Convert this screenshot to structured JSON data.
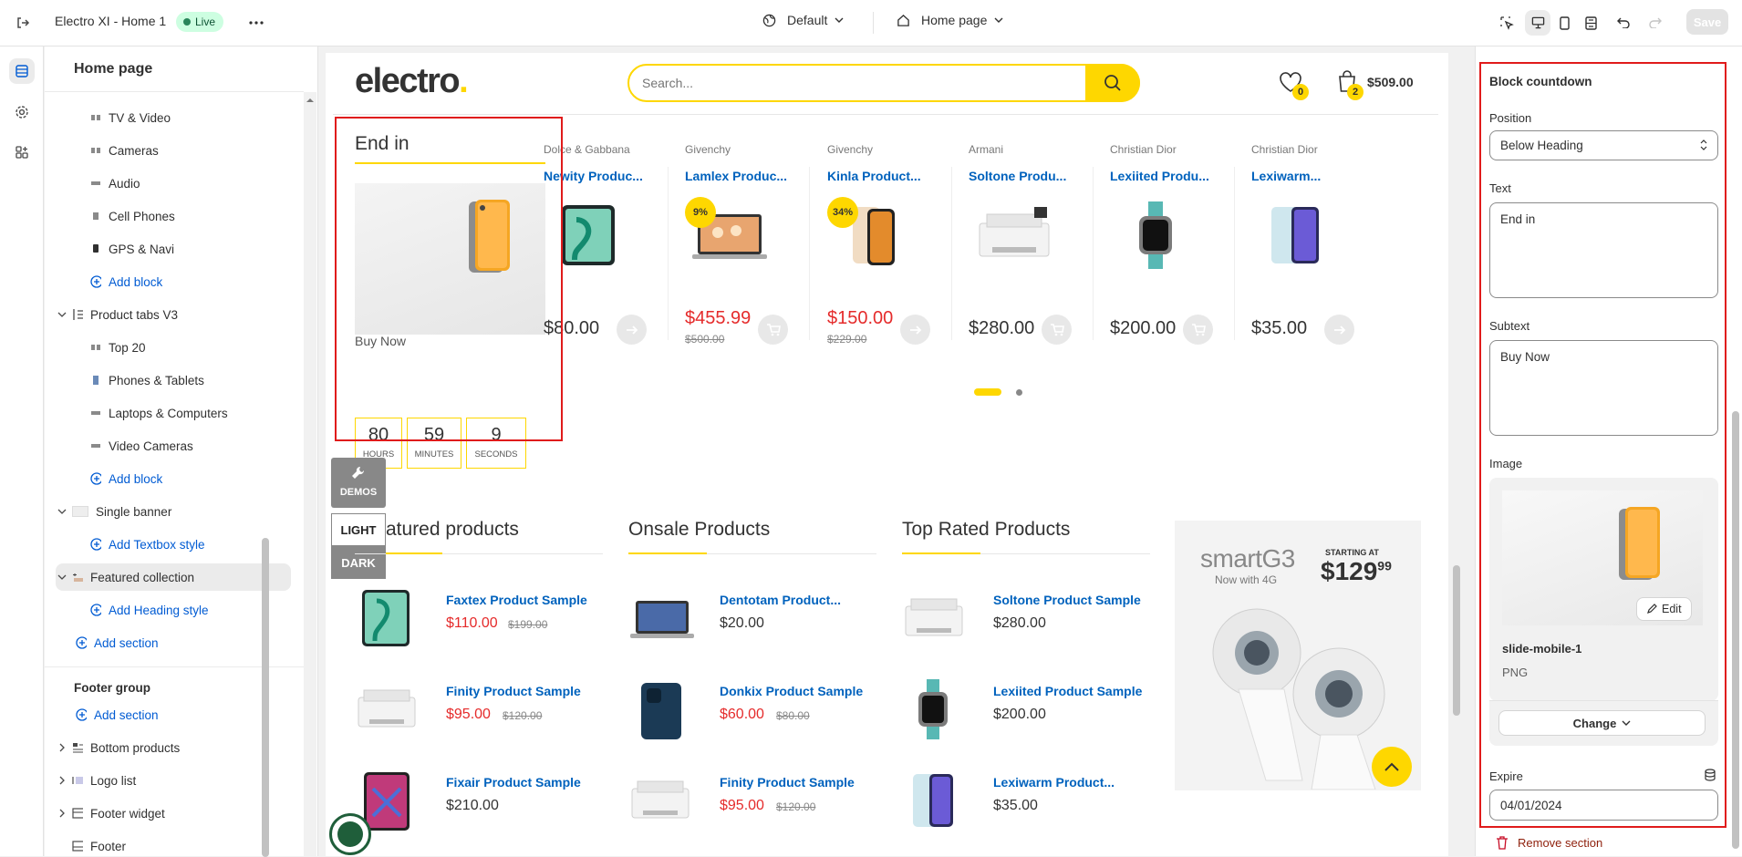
{
  "topbar": {
    "title": "Electro XI - Home 1",
    "status": "Live",
    "theme_select": "Default",
    "page_select": "Home page",
    "save_label": "Save"
  },
  "sidebar": {
    "heading": "Home page",
    "items": [
      {
        "label": "TV & Video"
      },
      {
        "label": "Cameras"
      },
      {
        "label": "Audio"
      },
      {
        "label": "Cell Phones"
      },
      {
        "label": "GPS & Navi"
      },
      {
        "label": "Add block"
      },
      {
        "label": "Product tabs V3"
      },
      {
        "label": "Top 20"
      },
      {
        "label": "Phones & Tablets"
      },
      {
        "label": "Laptops & Computers"
      },
      {
        "label": "Video Cameras"
      },
      {
        "label": "Add block"
      },
      {
        "label": "Single banner"
      },
      {
        "label": "Add Textbox style"
      },
      {
        "label": "Featured collection"
      },
      {
        "label": "Add Heading style"
      },
      {
        "label": "Add section"
      },
      {
        "label": "Footer group"
      },
      {
        "label": "Add section"
      },
      {
        "label": "Bottom products"
      },
      {
        "label": "Logo list"
      },
      {
        "label": "Footer widget"
      },
      {
        "label": "Footer"
      }
    ]
  },
  "store": {
    "logo": "electro",
    "search_placeholder": "Search...",
    "wishlist_count": "0",
    "cart_count": "2",
    "cart_total": "$509.00",
    "countdown": {
      "title": "End in",
      "subtext": "Buy Now",
      "hours": "80",
      "hours_label": "HOURS",
      "minutes": "59",
      "minutes_label": "MINUTES",
      "seconds": "9",
      "seconds_label": "SECONDS"
    },
    "products": [
      {
        "brand": "Dolce & Gabbana",
        "name": "Newity Produc...",
        "price": "$80.00",
        "old": "",
        "badge": ""
      },
      {
        "brand": "Givenchy",
        "name": "Lamlex Produc...",
        "price": "$455.99",
        "old": "$500.00",
        "badge": "9%"
      },
      {
        "brand": "Givenchy",
        "name": "Kinla Product...",
        "price": "$150.00",
        "old": "$229.00",
        "badge": "34%"
      },
      {
        "brand": "Armani",
        "name": "Soltone Produ...",
        "price": "$280.00",
        "old": "",
        "badge": ""
      },
      {
        "brand": "Christian Dior",
        "name": "Lexiited Produ...",
        "price": "$200.00",
        "old": "",
        "badge": ""
      },
      {
        "brand": "Christian Dior",
        "name": "Lexiwarm...",
        "price": "$35.00",
        "old": "",
        "badge": ""
      }
    ],
    "switcher": {
      "demos": "DEMOS",
      "light": "LIGHT",
      "dark": "DARK"
    },
    "columns": [
      {
        "title": "Featured products",
        "visible_title": "atured products",
        "items": [
          {
            "name": "Faxtex Product Sample",
            "price": "$110.00",
            "old": "$199.00"
          },
          {
            "name": "Finity Product Sample",
            "price": "$95.00",
            "old": "$120.00"
          },
          {
            "name": "Fixair Product Sample",
            "price": "$210.00",
            "old": ""
          }
        ]
      },
      {
        "title": "Onsale Products",
        "items": [
          {
            "name": "Dentotam Product...",
            "price": "$20.00",
            "old": ""
          },
          {
            "name": "Donkix Product Sample",
            "price": "$60.00",
            "old": "$80.00"
          },
          {
            "name": "Finity Product Sample",
            "price": "$95.00",
            "old": "$120.00"
          }
        ]
      },
      {
        "title": "Top Rated Products",
        "items": [
          {
            "name": "Soltone Product Sample",
            "price": "$280.00",
            "old": ""
          },
          {
            "name": "Lexiited Product Sample",
            "price": "$200.00",
            "old": ""
          },
          {
            "name": "Lexiwarm Product...",
            "price": "$35.00",
            "old": ""
          }
        ]
      }
    ],
    "banner": {
      "brand": "smartG3",
      "sub": "Now with 4G",
      "starting": "STARTING AT",
      "price_main": "$129",
      "price_cents": "99"
    }
  },
  "panel": {
    "title": "Block countdown",
    "position_label": "Position",
    "position_value": "Below Heading",
    "text_label": "Text",
    "text_value": "End in",
    "subtext_label": "Subtext",
    "subtext_value": "Buy Now",
    "image_label": "Image",
    "edit_label": "Edit",
    "image_name": "slide-mobile-1",
    "image_type": "PNG",
    "change_label": "Change",
    "expire_label": "Expire",
    "expire_value": "04/01/2024",
    "remove_label": "Remove section"
  },
  "colors": {
    "accent": "#fed700",
    "link": "#0062bd",
    "sale": "#e52b2b",
    "highlight": "#e01b1b",
    "admin_link": "#005bd3"
  },
  "icons": [
    "exit-icon",
    "more-icon",
    "globe-icon",
    "home-icon",
    "select-icon",
    "desktop-icon",
    "mobile-icon",
    "fullwidth-icon",
    "undo-icon",
    "redo-icon",
    "sections-icon",
    "settings-icon",
    "apps-icon",
    "heart-icon",
    "cart-icon",
    "search-icon",
    "wrench-icon",
    "arrow-up-icon",
    "trash-icon",
    "database-icon"
  ]
}
